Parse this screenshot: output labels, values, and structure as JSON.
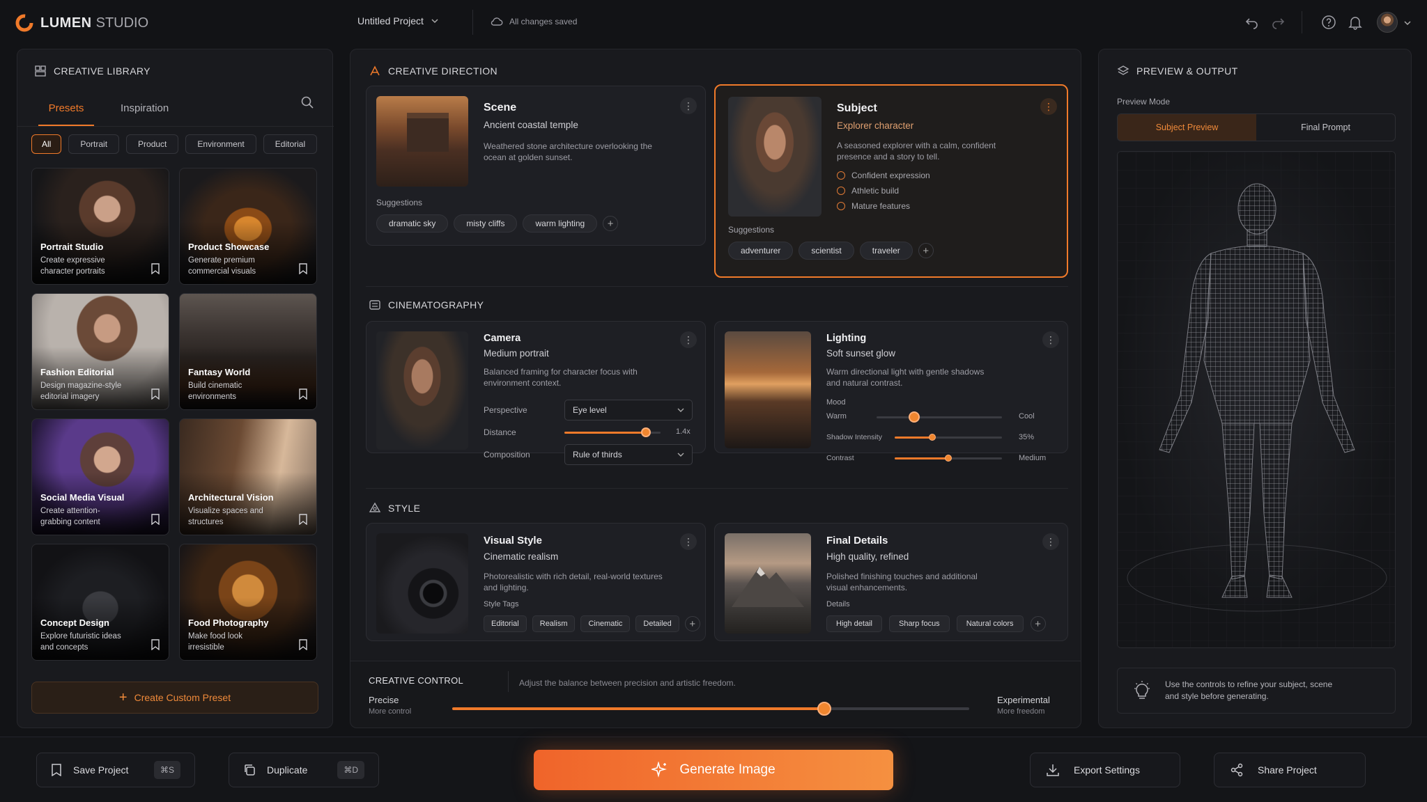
{
  "app": {
    "brand_primary": "LUMEN",
    "brand_secondary": "STUDIO",
    "project_name": "Untitled Project",
    "save_status": "All changes saved"
  },
  "library": {
    "title": "CREATIVE LIBRARY",
    "tabs": [
      {
        "label": "Presets",
        "active": true
      },
      {
        "label": "Inspiration",
        "active": false
      }
    ],
    "filters": [
      {
        "label": "All",
        "active": true
      },
      {
        "label": "Portrait"
      },
      {
        "label": "Product"
      },
      {
        "label": "Environment"
      },
      {
        "label": "Editorial"
      }
    ],
    "presets": [
      {
        "title": "Portrait Studio",
        "desc": "Create expressive character portraits"
      },
      {
        "title": "Product Showcase",
        "desc": "Generate premium commercial visuals"
      },
      {
        "title": "Fashion Editorial",
        "desc": "Design magazine-style editorial imagery"
      },
      {
        "title": "Fantasy World",
        "desc": "Build cinematic environments"
      },
      {
        "title": "Social Media Visual",
        "desc": "Create attention-grabbing content"
      },
      {
        "title": "Architectural Vision",
        "desc": "Visualize spaces and structures"
      },
      {
        "title": "Concept Design",
        "desc": "Explore futuristic ideas and concepts"
      },
      {
        "title": "Food Photography",
        "desc": "Make food look irresistible"
      }
    ],
    "create_label": "Create Custom Preset"
  },
  "direction": {
    "title": "CREATIVE DIRECTION",
    "scene": {
      "title": "Scene",
      "subtitle": "Ancient coastal temple",
      "desc": "Weathered stone architecture overlooking the ocean at golden sunset.",
      "suggestions_label": "Suggestions",
      "tags": [
        "dramatic sky",
        "misty cliffs",
        "warm lighting"
      ]
    },
    "subject": {
      "title": "Subject",
      "subtitle": "Explorer character",
      "desc": "A seasoned explorer with a calm, confident presence and a story to tell.",
      "traits": [
        "Confident expression",
        "Athletic build",
        "Mature features"
      ],
      "suggestions_label": "Suggestions",
      "tags": [
        "adventurer",
        "scientist",
        "traveler"
      ]
    }
  },
  "cinematography": {
    "title": "CINEMATOGRAPHY",
    "camera": {
      "title": "Camera",
      "subtitle": "Medium portrait",
      "desc": "Balanced framing for character focus with environment context.",
      "perspective_label": "Perspective",
      "perspective_value": "Eye level",
      "distance_label": "Distance",
      "distance_value": "1.4x",
      "distance_level": 0.85,
      "composition_label": "Composition",
      "composition_value": "Rule of thirds"
    },
    "lighting": {
      "title": "Lighting",
      "subtitle": "Soft sunset glow",
      "desc": "Warm directional light with gentle shadows and natural contrast.",
      "mood_label": "Mood",
      "mood_left": "Warm",
      "mood_right": "Cool",
      "mood_level": 0.3,
      "shadow_label": "Shadow Intensity",
      "shadow_value": "35%",
      "shadow_level": 0.35,
      "contrast_label": "Contrast",
      "contrast_value": "Medium",
      "contrast_level": 0.5
    }
  },
  "style": {
    "title": "STYLE",
    "visual": {
      "title": "Visual Style",
      "subtitle": "Cinematic realism",
      "desc": "Photorealistic with rich detail, real-world textures and lighting.",
      "tags_label": "Style Tags",
      "tags": [
        "Editorial",
        "Realism",
        "Cinematic",
        "Detailed"
      ]
    },
    "final": {
      "title": "Final Details",
      "subtitle": "High quality, refined",
      "desc": "Polished finishing touches and additional visual enhancements.",
      "tags_label": "Details",
      "tags": [
        "High detail",
        "Sharp focus",
        "Natural colors"
      ]
    }
  },
  "control": {
    "title": "CREATIVE CONTROL",
    "hint": "Adjust the balance between precision and artistic freedom.",
    "left": "Precise",
    "left_sub": "More control",
    "right": "Experimental",
    "right_sub": "More freedom",
    "level": 0.72
  },
  "preview": {
    "title": "PREVIEW & OUTPUT",
    "mode_label": "Preview Mode",
    "modes": [
      {
        "label": "Subject Preview",
        "active": true
      },
      {
        "label": "Final Prompt",
        "active": false
      }
    ],
    "tip": "Use the controls to refine your subject, scene and style before generating."
  },
  "footer": {
    "save": "Save Project",
    "save_kbd": "⌘S",
    "duplicate": "Duplicate",
    "duplicate_kbd": "⌘D",
    "generate": "Generate Image",
    "export": "Export Settings",
    "share": "Share Project"
  },
  "colors": {
    "accent": "#f07a2a",
    "background": "#121316",
    "panel": "#191a1e"
  }
}
